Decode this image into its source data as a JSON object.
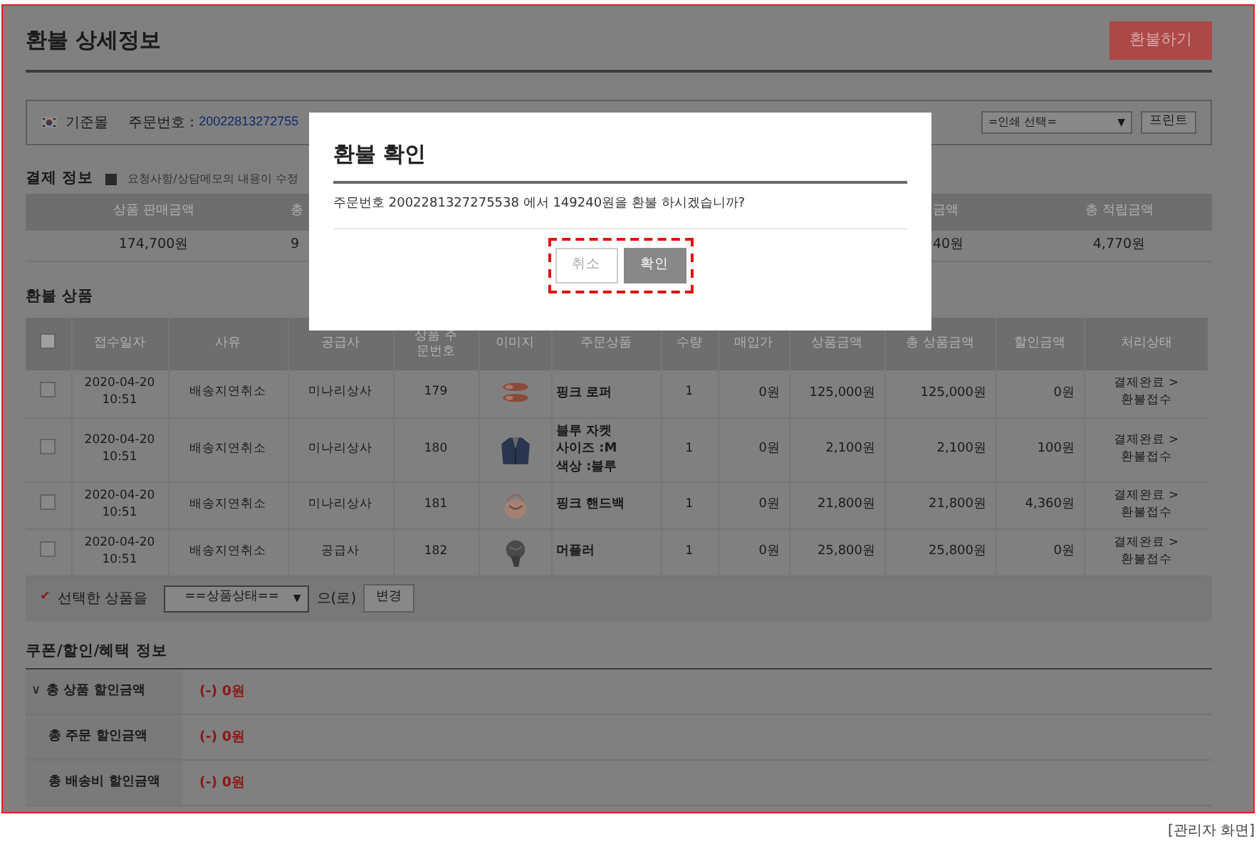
{
  "page": {
    "title": "환불 상세정보",
    "refund_button": "환불하기"
  },
  "info_bar": {
    "mall": "기준몰",
    "order_label": "주문번호 :",
    "order_number": "20022813272755",
    "print_select": "=인쇄 선택=",
    "print_select_caret": "▼",
    "print_button": "프린트"
  },
  "payment": {
    "title": "결제 정보",
    "note": "요청사항/상담메모의 내용이 수정",
    "columns": [
      "상품 판매금액",
      "총",
      "금액",
      "총 적립금액"
    ],
    "values": [
      "174,700원",
      "9",
      "40원",
      "4,770원"
    ]
  },
  "refund_items": {
    "title": "환불 상품",
    "select_all_checked": false,
    "columns": [
      "접수일자",
      "사유",
      "공급사",
      "상품 주문번호",
      "이미지",
      "주문상품",
      "수량",
      "매입가",
      "상품금액",
      "총 상품금액",
      "할인금액",
      "처리상태"
    ],
    "rows": [
      {
        "checked": false,
        "date": "2020-04-20",
        "time": "10:51",
        "reason": "배송지연취소",
        "supplier": "미나리상사",
        "item_no": "179",
        "product": [
          "핑크 로퍼"
        ],
        "qty": "1",
        "cost": "0원",
        "price": "125,000원",
        "total": "125,000원",
        "discount": "0원",
        "status": [
          "결제완료 >",
          "환불접수"
        ]
      },
      {
        "checked": false,
        "date": "2020-04-20",
        "time": "10:51",
        "reason": "배송지연취소",
        "supplier": "미나리상사",
        "item_no": "180",
        "product": [
          "블루 자켓",
          "사이즈 :M",
          "색상 :블루"
        ],
        "qty": "1",
        "cost": "0원",
        "price": "2,100원",
        "total": "2,100원",
        "discount": "100원",
        "status": [
          "결제완료 >",
          "환불접수"
        ]
      },
      {
        "checked": false,
        "date": "2020-04-20",
        "time": "10:51",
        "reason": "배송지연취소",
        "supplier": "미나리상사",
        "item_no": "181",
        "product": [
          "핑크 핸드백"
        ],
        "qty": "1",
        "cost": "0원",
        "price": "21,800원",
        "total": "21,800원",
        "discount": "4,360원",
        "status": [
          "결제완료 >",
          "환불접수"
        ]
      },
      {
        "checked": false,
        "date": "2020-04-20",
        "time": "10:51",
        "reason": "배송지연취소",
        "supplier": "공급사",
        "item_no": "182",
        "product": [
          "머플러"
        ],
        "qty": "1",
        "cost": "0원",
        "price": "25,800원",
        "total": "25,800원",
        "discount": "0원",
        "status": [
          "결제완료 >",
          "환불접수"
        ]
      }
    ]
  },
  "bulk": {
    "check": "✔",
    "label": "선택한 상품을",
    "select": "==상품상태==",
    "select_caret": "▼",
    "suffix": "으(로)",
    "button": "변경"
  },
  "benefits": {
    "title": "쿠폰/할인/혜택 정보",
    "rows": [
      {
        "kind": "toggle",
        "chevron": "∨",
        "label": "총 상품 할인금액",
        "value": "(-) 0원"
      },
      {
        "kind": "plain",
        "label": "총 주문 할인금액",
        "value": "(-) 0원"
      },
      {
        "kind": "plain",
        "label": "총 배송비 할인금액",
        "value": "(-) 0원"
      }
    ]
  },
  "modal": {
    "title": "환불 확인",
    "message": "주문번호 2002281327275538 에서 149240원을 환불 하시겠습니까?",
    "buttons": [
      {
        "label": "취소",
        "kind": "secondary"
      },
      {
        "label": "확인",
        "kind": "primary"
      }
    ]
  },
  "caption": "[관리자 화면]"
}
